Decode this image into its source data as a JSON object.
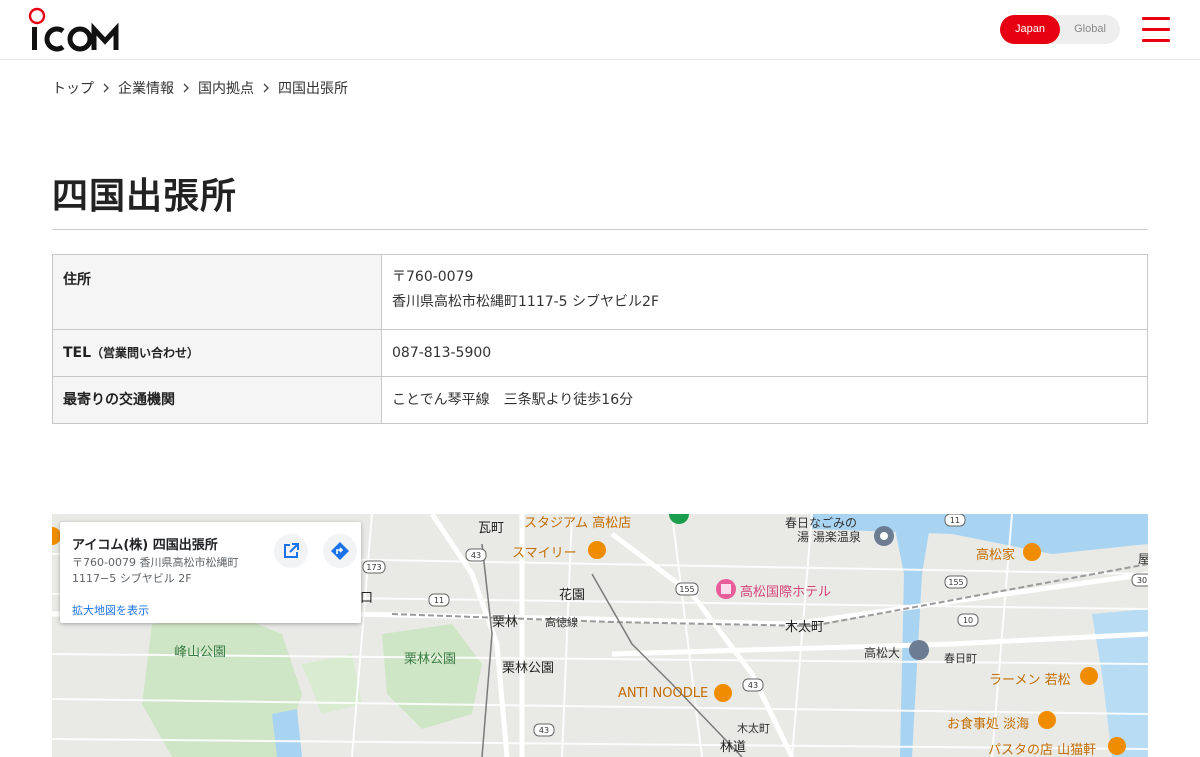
{
  "header": {
    "logo_text": "ICOM",
    "lang": {
      "japan": "Japan",
      "global": "Global"
    },
    "menu_icon": "hamburger-menu-icon",
    "accent_color": "#e60012"
  },
  "breadcrumb": [
    "トップ",
    "企業情報",
    "国内拠点",
    "四国出張所"
  ],
  "page_title": "四国出張所",
  "table": {
    "address_label": "住所",
    "address_postal": "〒760-0079",
    "address_line": "香川県高松市松縄町1117-5 シブヤビル2F",
    "tel_label": "TEL",
    "tel_note": "（営業問い合わせ）",
    "tel_value": "087-813-5900",
    "access_label": "最寄りの交通機関",
    "access_value": "ことでん琴平線　三条駅より徒歩16分"
  },
  "map": {
    "card": {
      "title": "アイコム(株) 四国出張所",
      "address": "〒760-0079 香川県高松市松縄町1117−5 シブヤビル 2F",
      "link": "拡大地図を表示"
    },
    "labels": {
      "stadium": "スタジアム 高松店",
      "kawaramachi": "瓦町",
      "smiley": "スマイリー",
      "kasuga_onsen_1": "春日なごみの",
      "kasuga_onsen_2": "湯 湯楽温泉",
      "takamatsuya": "高松家",
      "kaen": "花園",
      "hotel": "高松国際ホテル",
      "guchi": "口",
      "minenoyama": "峰山公園",
      "ritsurin": "栗林",
      "takatoku": "高徳線",
      "kitaro": "木太町",
      "ritsurin_park": "栗林公園",
      "ritsurin_park_st": "栗林公園",
      "takamatsu_univ": "高松大",
      "kasugacho": "春日町",
      "ramen": "ラーメン 若松",
      "anti_noodle": "ANTI NOODLE",
      "kitacho2": "木太町",
      "okujidokoro": "お食事処 淡海",
      "hayashimichi": "林道",
      "pasta": "パスタの店 山猫軒",
      "ya": "屋"
    },
    "road_numbers": [
      "43",
      "173",
      "11",
      "155",
      "155",
      "11",
      "10",
      "43",
      "43",
      "30"
    ]
  }
}
